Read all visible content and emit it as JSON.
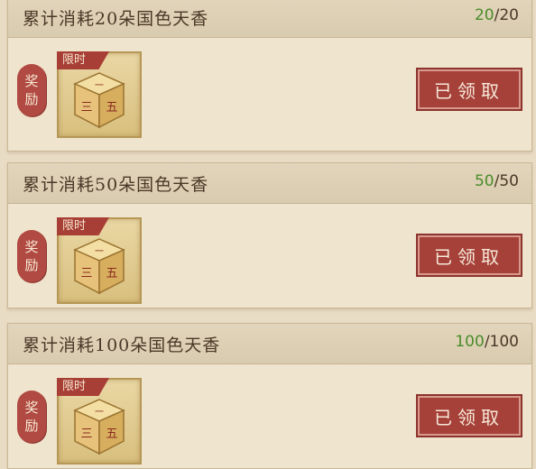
{
  "tasks": [
    {
      "title": "累计消耗20朵国色天香",
      "progress_current": "20",
      "progress_separator": "/",
      "progress_total": "20",
      "reward_label_1": "奖",
      "reward_label_2": "励",
      "limited_label": "限时",
      "button_label": "已领取"
    },
    {
      "title": "累计消耗50朵国色天香",
      "progress_current": "50",
      "progress_separator": "/",
      "progress_total": "50",
      "reward_label_1": "奖",
      "reward_label_2": "励",
      "limited_label": "限时",
      "button_label": "已领取"
    },
    {
      "title": "累计消耗100朵国色天香",
      "progress_current": "100",
      "progress_separator": "/",
      "progress_total": "100",
      "reward_label_1": "奖",
      "reward_label_2": "励",
      "limited_label": "限时",
      "button_label": "已领取"
    }
  ],
  "reward_item": {
    "icon": "dice-icon",
    "faces": [
      "一",
      "三",
      "五"
    ]
  },
  "colors": {
    "background": "#e9dcc4",
    "progress_green": "#4a8c2a",
    "button_red": "#a6413a",
    "tag_red": "#b04a42"
  }
}
